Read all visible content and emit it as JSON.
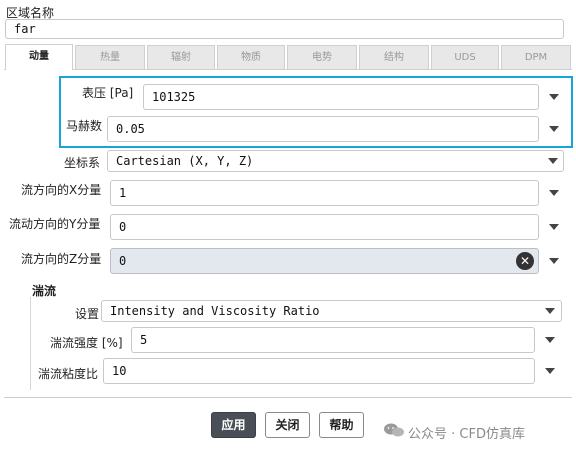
{
  "zone": {
    "label": "区域名称",
    "value": "far"
  },
  "tabs": [
    {
      "label": "动量"
    },
    {
      "label": "热量"
    },
    {
      "label": "辐射"
    },
    {
      "label": "物质"
    },
    {
      "label": "电势"
    },
    {
      "label": "结构"
    },
    {
      "label": "UDS"
    },
    {
      "label": "DPM"
    }
  ],
  "momentum": {
    "pressure": {
      "label": "表压 [Pa]",
      "value": "101325"
    },
    "mach": {
      "label": "马赫数",
      "value": "0.05"
    },
    "coord": {
      "label": "坐标系",
      "value": "Cartesian (X, Y, Z)"
    },
    "x_dir": {
      "label": "流方向的X分量",
      "value": "1"
    },
    "y_dir": {
      "label": "流动方向的Y分量",
      "value": "0"
    },
    "z_dir": {
      "label": "流方向的Z分量",
      "value": "0"
    }
  },
  "turbulence": {
    "title": "湍流",
    "method": {
      "label": "设置",
      "value": "Intensity and Viscosity Ratio"
    },
    "intensity": {
      "label": "湍流强度 [%]",
      "value": "5"
    },
    "viscosity_ratio": {
      "label": "湍流粘度比",
      "value": "10"
    }
  },
  "buttons": {
    "apply": "应用",
    "close": "关闭",
    "help": "帮助"
  },
  "watermark": "公众号 · CFD仿真库",
  "colors": {
    "highlight": "#1aa3d8",
    "primary_button": "#4a4f57",
    "disabled_field": "#e3e7ee"
  }
}
